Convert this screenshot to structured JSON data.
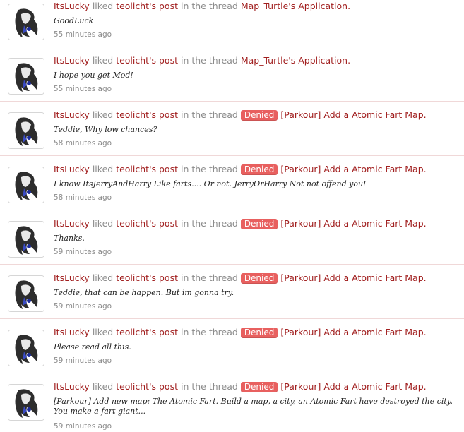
{
  "feed": {
    "items": [
      {
        "user": "ItsLucky",
        "action": "liked",
        "post": "teolicht's post",
        "in_thread": "in the thread",
        "prefix": "",
        "prefix_text": "",
        "thread": "Map_Turtle's Application.",
        "snippet": "GoodLuck",
        "time": "55 minutes ago"
      },
      {
        "user": "ItsLucky",
        "action": "liked",
        "post": "teolicht's post",
        "in_thread": "in the thread",
        "prefix": "",
        "prefix_text": "",
        "thread": "Map_Turtle's Application.",
        "snippet": "I hope you get Mod!",
        "time": "55 minutes ago"
      },
      {
        "user": "ItsLucky",
        "action": "liked",
        "post": "teolicht's post",
        "in_thread": "in the thread",
        "prefix": "Denied",
        "prefix_text": "[Parkour]",
        "thread": "Add a Atomic Fart Map.",
        "snippet": "Teddie, Why low chances?",
        "time": "58 minutes ago"
      },
      {
        "user": "ItsLucky",
        "action": "liked",
        "post": "teolicht's post",
        "in_thread": "in the thread",
        "prefix": "Denied",
        "prefix_text": "[Parkour]",
        "thread": "Add a Atomic Fart Map.",
        "snippet": "I know ItsJerryAndHarry Like farts.... Or not. JerryOrHarry Not not offend you!",
        "time": "58 minutes ago"
      },
      {
        "user": "ItsLucky",
        "action": "liked",
        "post": "teolicht's post",
        "in_thread": "in the thread",
        "prefix": "Denied",
        "prefix_text": "[Parkour]",
        "thread": "Add a Atomic Fart Map.",
        "snippet": "Thanks.",
        "time": "59 minutes ago"
      },
      {
        "user": "ItsLucky",
        "action": "liked",
        "post": "teolicht's post",
        "in_thread": "in the thread",
        "prefix": "Denied",
        "prefix_text": "[Parkour]",
        "thread": "Add a Atomic Fart Map.",
        "snippet": "Teddie, that can be happen. But im gonna try.",
        "time": "59 minutes ago"
      },
      {
        "user": "ItsLucky",
        "action": "liked",
        "post": "teolicht's post",
        "in_thread": "in the thread",
        "prefix": "Denied",
        "prefix_text": "[Parkour]",
        "thread": "Add a Atomic Fart Map.",
        "snippet": "Please read all this.",
        "time": "59 minutes ago"
      },
      {
        "user": "ItsLucky",
        "action": "liked",
        "post": "teolicht's post",
        "in_thread": "in the thread",
        "prefix": "Denied",
        "prefix_text": "[Parkour]",
        "thread": "Add a Atomic Fart Map.",
        "snippet": "[Parkour] Add new map: The Atomic Fart. Build a map, a city, an Atomic Fart have destroyed the city. You make a fart giant...",
        "time": "59 minutes ago"
      }
    ]
  },
  "colors": {
    "link": "#a11f1f",
    "muted": "#8c8c8c",
    "prefix_bg": "#e8605f"
  }
}
